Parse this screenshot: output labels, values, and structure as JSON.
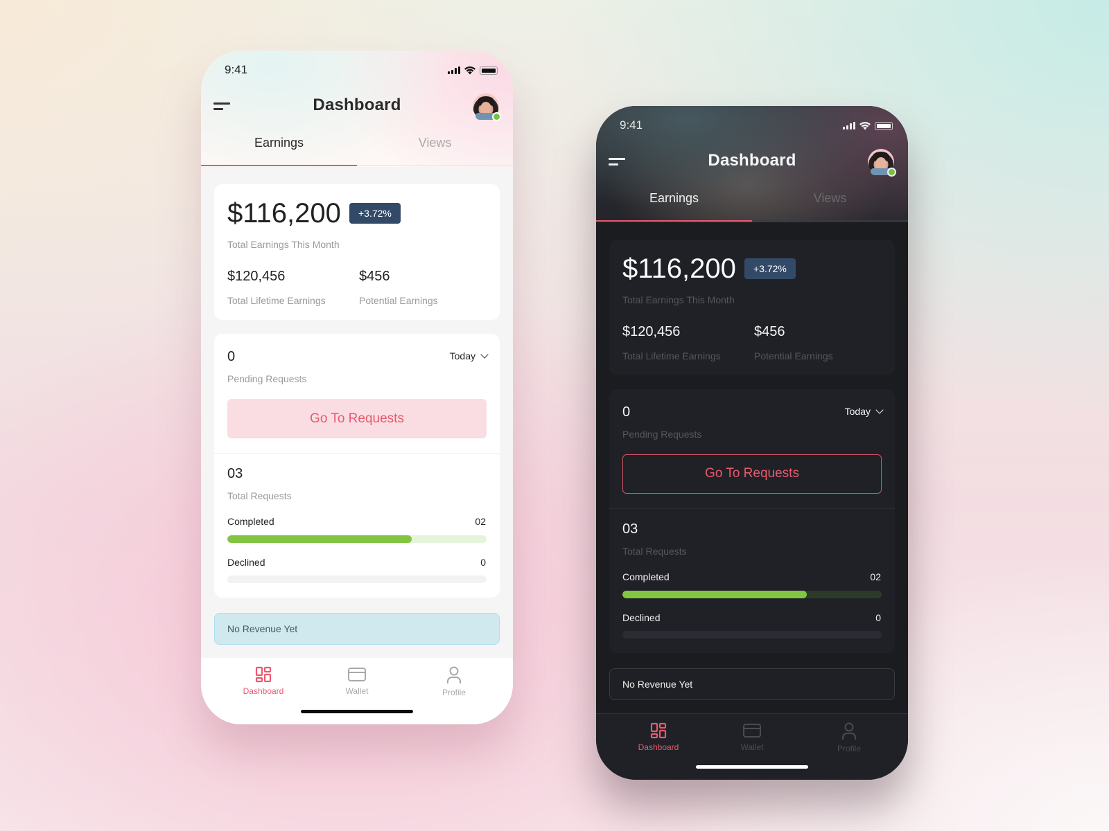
{
  "colors": {
    "accent": "#e8596c",
    "badge_bg": "#324a68",
    "progress_green": "#82c542",
    "online_green": "#77c043"
  },
  "phones": {
    "light": {
      "theme": "light",
      "status": {
        "time": "9:41"
      },
      "header": {
        "title": "Dashboard",
        "menu_icon": "menu-icon",
        "avatar": "user-avatar"
      },
      "tabs": [
        {
          "label": "Earnings",
          "active": true
        },
        {
          "label": "Views",
          "active": false
        }
      ],
      "earnings": {
        "total_month": "$116,200",
        "change_badge": "+3.72%",
        "total_month_label": "Total Earnings This Month",
        "lifetime": "$120,456",
        "lifetime_label": "Total Lifetime Earnings",
        "potential": "$456",
        "potential_label": "Potential Earnings"
      },
      "requests": {
        "pending_count": "0",
        "pending_label": "Pending Requests",
        "period_select": "Today",
        "go_button": "Go To Requests",
        "total_count": "03",
        "total_label": "Total Requests",
        "completed_label": "Completed",
        "completed_value": "02",
        "completed_progress": 0.71,
        "declined_label": "Declined",
        "declined_value": "0",
        "declined_progress": 0
      },
      "notice": "No Revenue Yet",
      "nav": [
        {
          "label": "Dashboard",
          "icon": "dashboard-icon",
          "active": true
        },
        {
          "label": "Wallet",
          "icon": "wallet-icon",
          "active": false
        },
        {
          "label": "Profile",
          "icon": "profile-icon",
          "active": false
        }
      ]
    },
    "dark": {
      "theme": "dark",
      "status": {
        "time": "9:41"
      },
      "header": {
        "title": "Dashboard",
        "menu_icon": "menu-icon",
        "avatar": "user-avatar"
      },
      "tabs": [
        {
          "label": "Earnings",
          "active": true
        },
        {
          "label": "Views",
          "active": false
        }
      ],
      "earnings": {
        "total_month": "$116,200",
        "change_badge": "+3.72%",
        "total_month_label": "Total Earnings This Month",
        "lifetime": "$120,456",
        "lifetime_label": "Total Lifetime Earnings",
        "potential": "$456",
        "potential_label": "Potential Earnings"
      },
      "requests": {
        "pending_count": "0",
        "pending_label": "Pending Requests",
        "period_select": "Today",
        "go_button": "Go To Requests",
        "total_count": "03",
        "total_label": "Total Requests",
        "completed_label": "Completed",
        "completed_value": "02",
        "completed_progress": 0.71,
        "declined_label": "Declined",
        "declined_value": "0",
        "declined_progress": 0
      },
      "notice": "No Revenue Yet",
      "nav": [
        {
          "label": "Dashboard",
          "icon": "dashboard-icon",
          "active": true
        },
        {
          "label": "Wallet",
          "icon": "wallet-icon",
          "active": false
        },
        {
          "label": "Profile",
          "icon": "profile-icon",
          "active": false
        }
      ]
    }
  }
}
